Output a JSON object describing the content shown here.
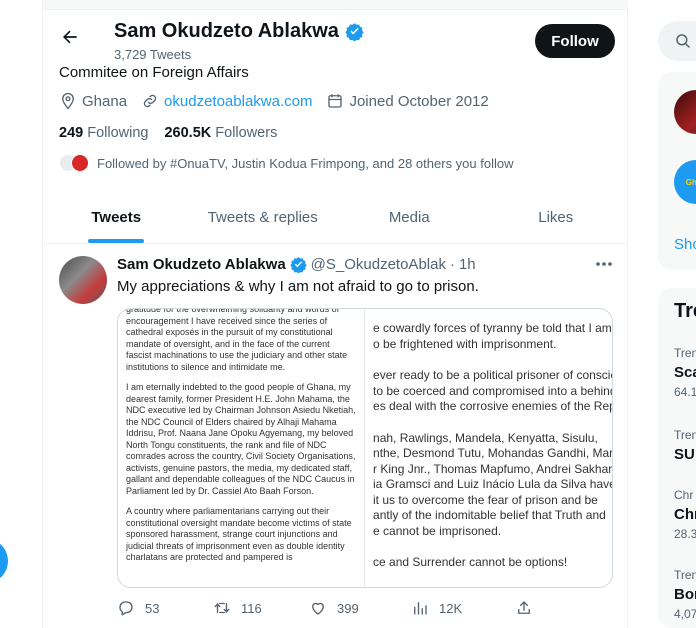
{
  "profile": {
    "name": "Sam Okudzeto Ablakwa",
    "tweet_count": "3,729 Tweets",
    "follow_label": "Follow",
    "bio": "Commitee on Foreign Affairs",
    "location": "Ghana",
    "website": "okudzetoablakwa.com",
    "joined": "Joined October 2012",
    "following_count": "249",
    "following_label": "Following",
    "followers_count": "260.5K",
    "followers_label": "Followers",
    "followed_by": "Followed by #OnuaTV, Justin Kodua Frimpong, and 28 others you follow"
  },
  "tabs": [
    {
      "label": "Tweets",
      "active": true
    },
    {
      "label": "Tweets & replies",
      "active": false
    },
    {
      "label": "Media",
      "active": false
    },
    {
      "label": "Likes",
      "active": false
    }
  ],
  "tweet": {
    "name": "Sam Okudzeto Ablakwa",
    "handle": "@S_OkudzetoAblak",
    "dot": "·",
    "time": "1h",
    "text": "My appreciations & why I am not afraid to go to prison.",
    "doc_left": [
      "gratitude for the overwhelming solidarity and words of encouragement I have received since the series of cathedral exposés in the pursuit of my constitutional mandate of oversight, and in the face of the current fascist machinations to use the judiciary and other state institutions to silence and intimidate me.",
      "I am eternally indebted to the good people of Ghana, my dearest family, former President H.E. John Mahama, the NDC executive led by Chairman Johnson Asiedu Nketiah, the NDC Council of Elders chaired by Alhaji Mahama Iddrisu, Prof. Naana Jane Opoku Agyemang, my beloved North Tongu constituents, the rank and file of NDC comrades across the country, Civil Society Organisations, activists, genuine pastors, the media, my dedicated staff, gallant and dependable colleagues of the NDC Caucus in Parliament led by Dr. Cassiel Ato Baah Forson.",
      "A country where parliamentarians carrying out their constitutional oversight mandate become victims of state sponsored harassment, strange court injunctions and judicial threats of imprisonment even as double identity charlatans are protected and pampered is"
    ],
    "doc_right": [
      "e cowardly forces of tyranny be told that I am",
      "o be frightened with imprisonment.",
      "",
      "ever ready to be a political prisoner of conscien",
      "to be coerced and compromised into a behind",
      "es deal with the corrosive enemies of the Repu",
      "",
      "nah, Rawlings, Mandela, Kenyatta, Sisulu,",
      "nthe, Desmond Tutu, Mohandas Gandhi, Marti",
      "r King Jnr., Thomas Mapfumo, Andrei Sakharo",
      "ia Gramsci and Luiz Inácio Lula da Silva have a",
      "it us to overcome the fear of prison and be",
      "antly of the indomitable belief that Truth and",
      "e cannot be imprisoned.",
      "",
      "ce and Surrender cannot be options!"
    ],
    "replies": "53",
    "retweets": "116",
    "likes": "399",
    "views": "12K"
  },
  "sidebar_right": {
    "show_more": "Sho",
    "avatar2_text": "Ghan",
    "trends_title": "Tre",
    "trends": [
      {
        "category": "Tren",
        "name": "Sca",
        "count": "64.1"
      },
      {
        "category": "Tren",
        "name": "SU",
        "count": ""
      },
      {
        "category": "Chr",
        "name": "Chr",
        "count": "28.3"
      },
      {
        "category": "Tren",
        "name": "Bor",
        "count": "4,07"
      }
    ]
  },
  "colors": {
    "accent": "#1d9bf0",
    "text": "#0f1419",
    "muted": "#536471"
  }
}
